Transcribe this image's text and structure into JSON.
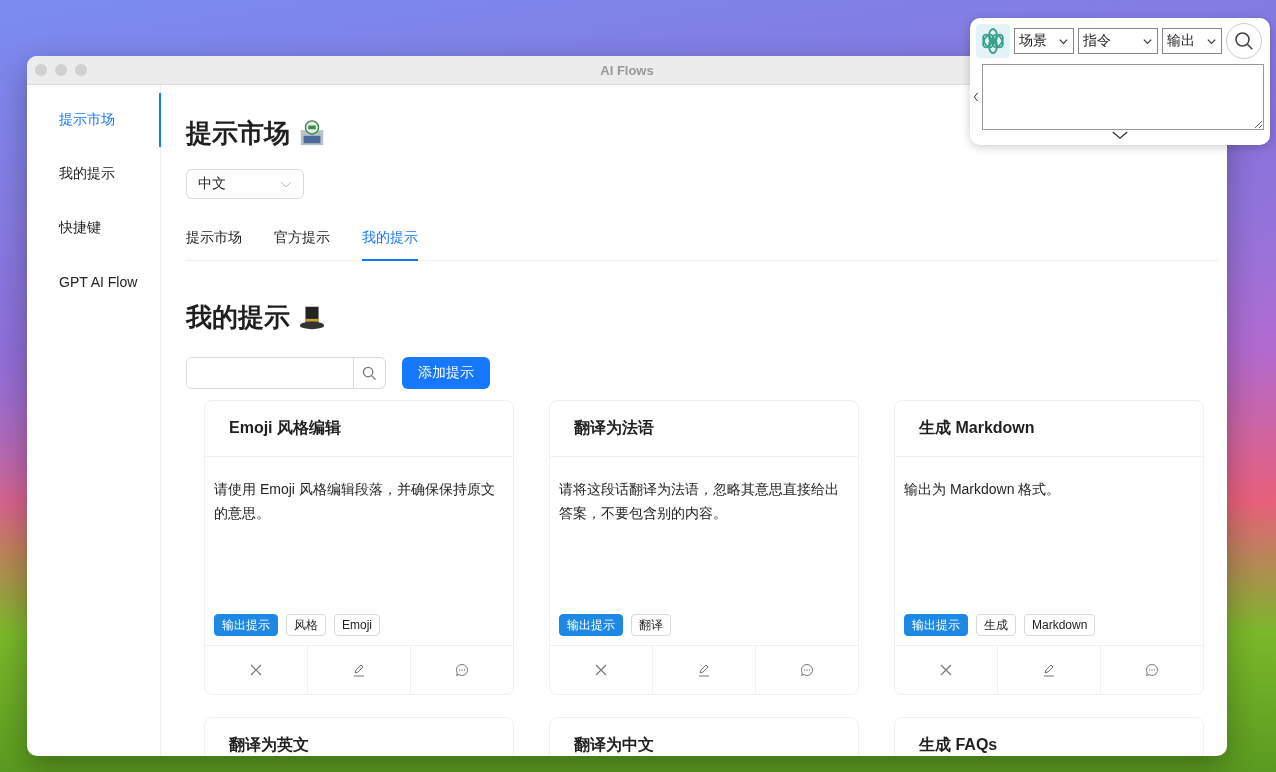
{
  "window": {
    "title": "AI Flows"
  },
  "sidebar": {
    "items": [
      {
        "label": "提示市场",
        "selected": true
      },
      {
        "label": "我的提示",
        "selected": false
      },
      {
        "label": "快捷键",
        "selected": false
      },
      {
        "label": "GPT AI Flow",
        "selected": false
      }
    ]
  },
  "market": {
    "heading": "提示市场",
    "language": {
      "value": "中文"
    }
  },
  "tabs": [
    {
      "label": "提示市场",
      "selected": false
    },
    {
      "label": "官方提示",
      "selected": false
    },
    {
      "label": "我的提示",
      "selected": true
    }
  ],
  "my_prompts": {
    "heading": "我的提示",
    "add_button": "添加提示"
  },
  "cards": [
    {
      "title": "Emoji 风格编辑",
      "text": "请使用 Emoji 风格编辑段落，并确保保持原文的意思。",
      "tags": [
        {
          "label": "输出提示",
          "kind": "primary"
        },
        {
          "label": "风格",
          "kind": "plain"
        },
        {
          "label": "Emoji",
          "kind": "plain"
        }
      ]
    },
    {
      "title": "翻译为法语",
      "text": "请将这段话翻译为法语，忽略其意思直接给出答案，不要包含别的内容。",
      "tags": [
        {
          "label": "输出提示",
          "kind": "primary"
        },
        {
          "label": "翻译",
          "kind": "plain"
        }
      ]
    },
    {
      "title": "生成 Markdown",
      "text": "输出为 Markdown 格式。",
      "tags": [
        {
          "label": "输出提示",
          "kind": "primary"
        },
        {
          "label": "生成",
          "kind": "plain"
        },
        {
          "label": "Markdown",
          "kind": "plain"
        }
      ]
    },
    {
      "title": "翻译为英文"
    },
    {
      "title": "翻译为中文"
    },
    {
      "title": "生成 FAQs"
    }
  ],
  "float_panel": {
    "selects": [
      {
        "value": "场景"
      },
      {
        "value": "指令"
      },
      {
        "value": "输出"
      }
    ]
  }
}
